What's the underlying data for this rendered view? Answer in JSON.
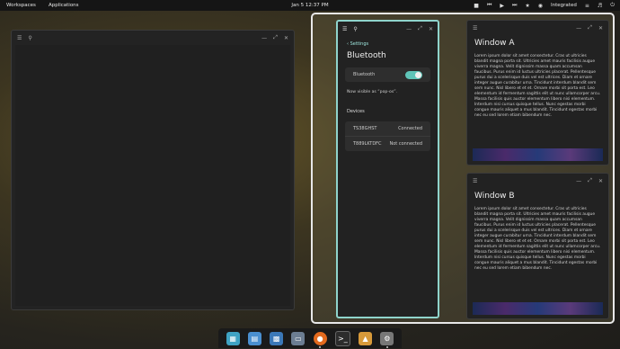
{
  "topbar": {
    "workspaces": "Workspaces",
    "applications": "Applications",
    "clock": "Jan 5 12:37 PM",
    "graphics_mode": "Integrated"
  },
  "settings": {
    "back_label": "Settings",
    "title": "Bluetooth",
    "toggle_label": "Bluetooth",
    "toggle_on": true,
    "visible_note": "Now visible as “pop-os”.",
    "devices_header": "Devices",
    "devices": [
      {
        "name": "TS38GHST",
        "status": "Connected"
      },
      {
        "name": "T889LKTDFC",
        "status": "Not connected"
      }
    ]
  },
  "window_a": {
    "title": "Window A",
    "text": "Lorem ipsum dolor sit amet consectetur. Cras ut ultricies blandit magna porta sit. Ultricies amet mauris facilisis augue viverra magna. Velit dignissim massa quam accumsan faucibus. Purus enim id luctus ultricies placerat. Pellentesque purus dui a scelerisque duis vel est ultrices. Diam et ornare integer augue curabitur urna. Tincidunt interdum blandit sem sem nunc. Nisl libero et et et. Ornare morbi sit porta est. Leo elementum id fermentum sagittis elit ut nunc ullamcorper arcu. Massa facilisis quis auctor elementum libero nisi elementum. Interdum nisi cursus quisque tellus. Nunc egestas morbi congue mauris aliquet a mus blandit. Tincidunt egestas morbi nec eu sed lorem etiam bibendum nec."
  },
  "window_b": {
    "title": "Window B",
    "text": "Lorem ipsum dolor sit amet consectetur. Cras ut ultricies blandit magna porta sit. Ultricies amet mauris facilisis augue viverra magna. Velit dignissim massa quam accumsan faucibus. Purus enim id luctus ultricies placerat. Pellentesque purus dui a scelerisque duis vel est ultrices. Diam et ornare integer augue curabitur urna. Tincidunt interdum blandit sem sem nunc. Nisl libero et et et. Ornare morbi sit porta est. Leo elementum id fermentum sagittis elit ut nunc ullamcorper arcu. Massa facilisis quis auctor elementum libero nisi elementum. Interdum nisi cursus quisque tellus. Nunc egestas morbi congue mauris aliquet a mus blandit. Tincidunt egestas morbi nec eu sed lorem etiam bibendum nec."
  },
  "colors": {
    "accent": "#8fd4cc",
    "toggle": "#5fc4b8",
    "panel": "#151515"
  },
  "dock": [
    {
      "name": "pop-shop-icon",
      "color": "#3fa3c4"
    },
    {
      "name": "gnome-tweaks-icon",
      "color": "#4a8fd0"
    },
    {
      "name": "gallery-icon",
      "color": "#3b78b8"
    },
    {
      "name": "files-icon",
      "color": "#6c7d92"
    },
    {
      "name": "firefox-icon",
      "color": "#e36a1e"
    },
    {
      "name": "terminal-icon",
      "color": "#2c2c2c"
    },
    {
      "name": "image-viewer-icon",
      "color": "#d89a3a"
    },
    {
      "name": "settings-icon",
      "color": "#777777"
    }
  ]
}
